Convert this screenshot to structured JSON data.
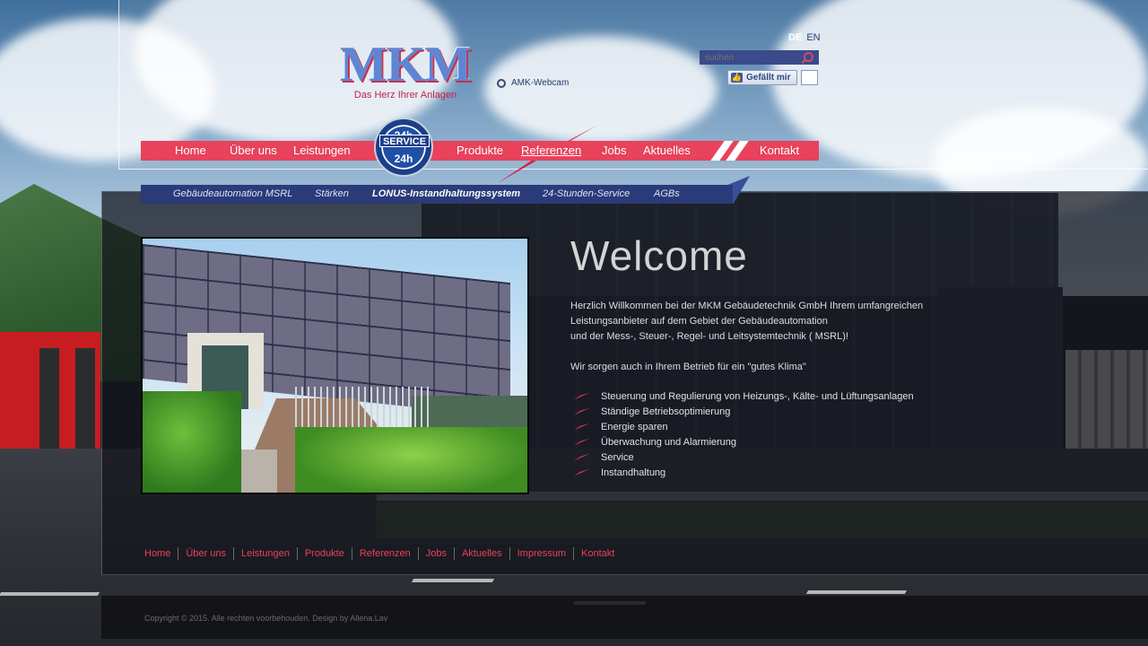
{
  "header": {
    "logo_text": "MKM",
    "slogan": "Das Herz Ihrer Anlagen",
    "webcam_label": "AMK-Webcam",
    "languages": [
      "DE",
      "EN"
    ],
    "search_placeholder": "suchen",
    "like_label": "Gefällt mir"
  },
  "badge": {
    "top": "24h",
    "band": "SERVICE",
    "bottom": "24h"
  },
  "main_nav": {
    "items": [
      "Home",
      "Über uns",
      "Leistungen",
      "Produkte",
      "Referenzen",
      "Jobs",
      "Aktuelles",
      "Kontakt"
    ],
    "active": "Referenzen"
  },
  "sub_nav": {
    "items": [
      "Gebäudeautomation MSRL",
      "Stärken",
      "LONUS-Instandhaltungssystem",
      "24-Stunden-Service",
      "AGBs"
    ],
    "active": "LONUS-Instandhaltungssystem"
  },
  "content": {
    "heading": "Welcome",
    "intro_lines": [
      "Herzlich Willkommen bei der MKM Gebäudetechnik GmbH Ihrem umfangreichen",
      "Leistungsanbieter auf dem Gebiet der Gebäudeautomation",
      "und der Mess-, Steuer-, Regel- und Leitsystemtechnik ( MSRL)!"
    ],
    "climate_line": "Wir sorgen auch in Ihrem Betrieb für ein \"gutes Klima\"",
    "features": [
      "Steuerung und Regulierung von Heizungs-, Kälte- und Lüftungsanlagen",
      "Ständige Betriebsoptimierung",
      "Energie sparen",
      "Überwachung und Alarmierung",
      "Service",
      "Instandhaltung"
    ]
  },
  "footer": {
    "links": [
      "Home",
      "Über uns",
      "Leistungen",
      "Produkte",
      "Referenzen",
      "Jobs",
      "Aktuelles",
      "Impressum",
      "Kontakt"
    ],
    "copyright": "Copyright © 2015. Alle rechten voorbehouden. Design by Allena.Lav"
  },
  "colors": {
    "nav_red": "#e8425c",
    "subnav_blue": "#2a3b79",
    "link_red": "#e8425c",
    "logo_blue": "#5d86d4"
  }
}
